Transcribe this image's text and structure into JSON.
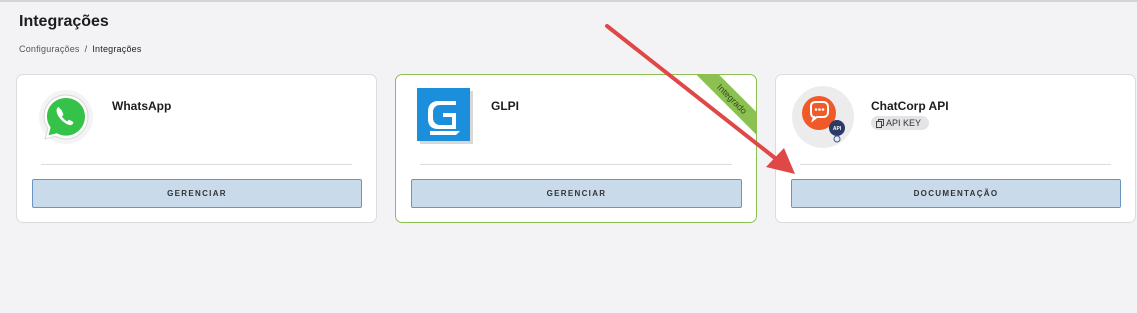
{
  "page": {
    "title": "Integrações",
    "breadcrumb": {
      "parent": "Configurações",
      "separator": "/",
      "current": "Integrações"
    }
  },
  "cards": [
    {
      "title": "WhatsApp",
      "icon": "whatsapp-icon",
      "button_label": "GERENCIAR"
    },
    {
      "title": "GLPI",
      "icon": "glpi-icon",
      "button_label": "GERENCIAR",
      "ribbon": "Integrado"
    },
    {
      "title": "ChatCorp API",
      "icon": "chat-api-icon",
      "badge_label": "API KEY",
      "badge_icon": "copy-icon",
      "button_label": "DOCUMENTAÇÃO"
    }
  ],
  "colors": {
    "background": "#f3f3f5",
    "button_fill": "#c9daea",
    "button_border": "#6b94c2",
    "integrated_accent": "#8cc152",
    "annotation_arrow": "#e04848"
  }
}
